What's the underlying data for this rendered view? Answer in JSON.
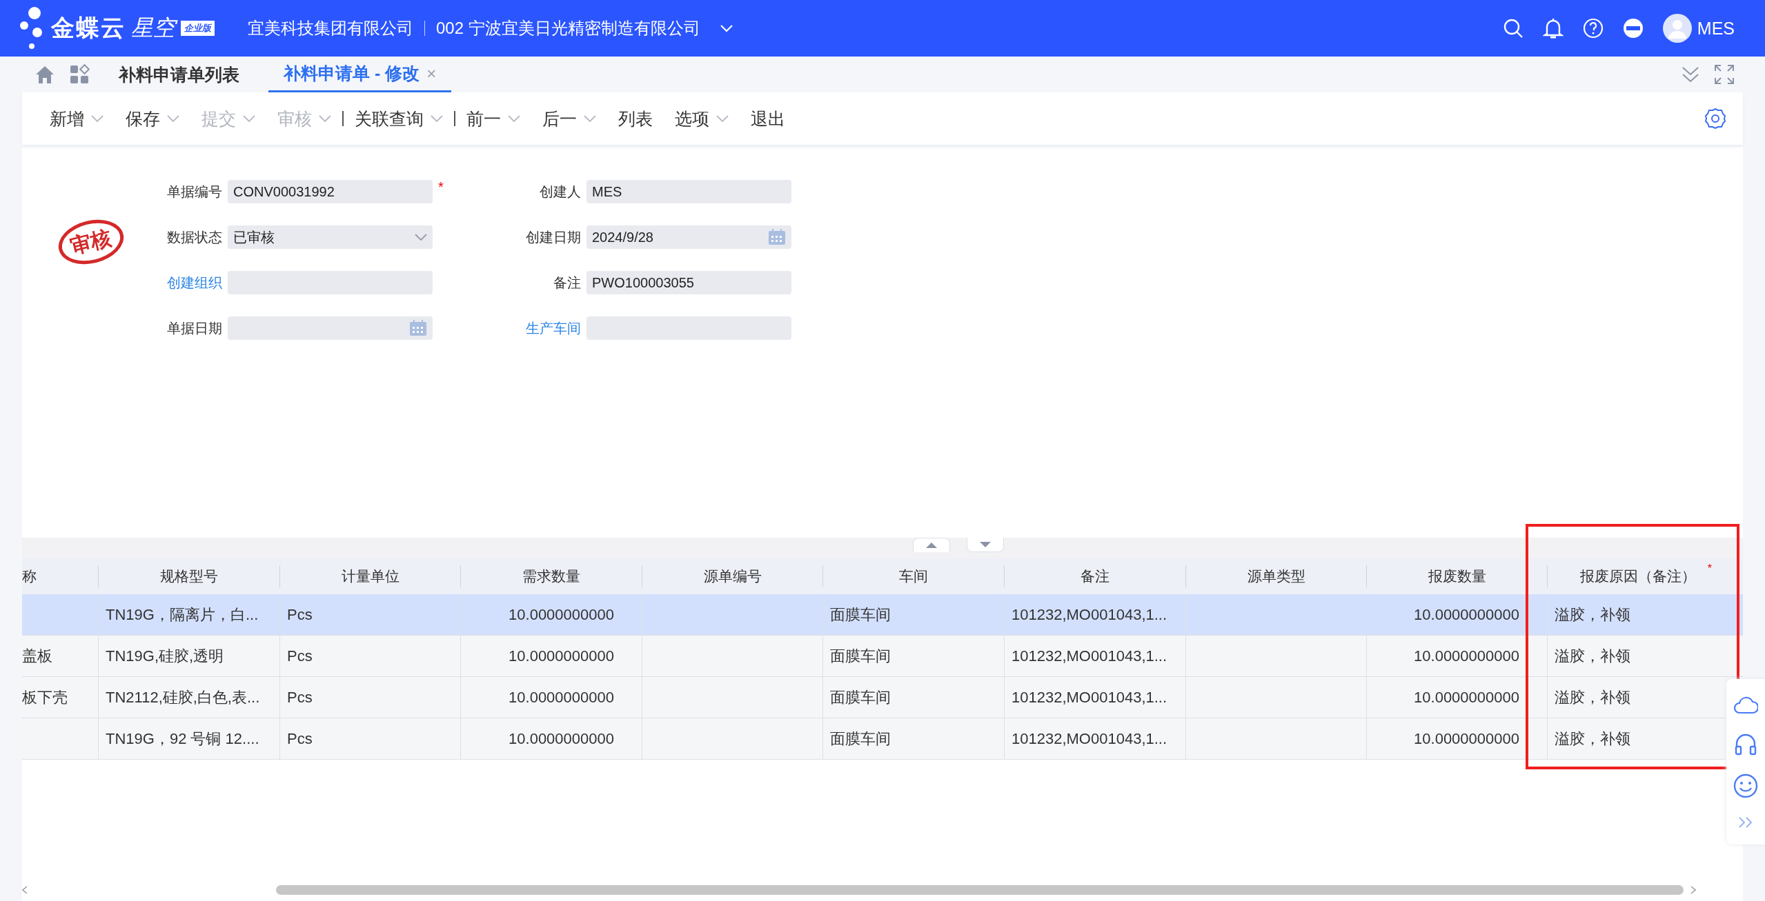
{
  "header": {
    "logo_text": "金蝶云",
    "logo_sub": "星空",
    "edition": "企业版",
    "company": "宜美科技集团有限公司",
    "org": "002 宁波宜美日光精密制造有限公司",
    "user": "MES"
  },
  "tabs": [
    {
      "label": "补料申请单列表",
      "selected": false,
      "closable": false
    },
    {
      "label": "补料申请单 - 修改",
      "selected": true,
      "closable": true
    }
  ],
  "close_glyph": "×",
  "toolbar": [
    {
      "label": "新增",
      "dropdown": true,
      "disabled": false,
      "separator_after": false
    },
    {
      "label": "保存",
      "dropdown": true,
      "disabled": false,
      "separator_after": false
    },
    {
      "label": "提交",
      "dropdown": true,
      "disabled": true,
      "separator_after": false
    },
    {
      "label": "审核",
      "dropdown": true,
      "disabled": true,
      "separator_after": true
    },
    {
      "label": "关联查询",
      "dropdown": true,
      "disabled": false,
      "separator_after": true
    },
    {
      "label": "前一",
      "dropdown": true,
      "disabled": false,
      "separator_after": false
    },
    {
      "label": "后一",
      "dropdown": true,
      "disabled": false,
      "separator_after": false
    },
    {
      "label": "列表",
      "dropdown": false,
      "disabled": false,
      "separator_after": false
    },
    {
      "label": "选项",
      "dropdown": true,
      "disabled": false,
      "separator_after": false
    },
    {
      "label": "退出",
      "dropdown": false,
      "disabled": false,
      "separator_after": false
    }
  ],
  "stamp": "审核",
  "form_left": [
    {
      "label": "单据编号",
      "value": "CONV00031992",
      "kind": "text",
      "link": false,
      "required": true
    },
    {
      "label": "数据状态",
      "value": "已审核",
      "kind": "select",
      "link": false,
      "required": false
    },
    {
      "label": "创建组织",
      "kind": "text",
      "link": true,
      "required": false
    },
    {
      "label": "单据日期",
      "kind": "date",
      "link": false,
      "required": false
    }
  ],
  "form_right": [
    {
      "label": "创建人",
      "value": "MES",
      "kind": "text",
      "link": false,
      "required": false
    },
    {
      "label": "创建日期",
      "value": "2024/9/28",
      "kind": "date",
      "link": false,
      "required": false
    },
    {
      "label": "备注",
      "value": "PWO100003055",
      "kind": "text",
      "link": false,
      "required": false
    },
    {
      "label": "生产车间",
      "kind": "text",
      "link": true,
      "required": false
    }
  ],
  "required_mark": "*",
  "table": {
    "columns": [
      {
        "label": "称",
        "kind": "text",
        "required": false,
        "highlighted": false
      },
      {
        "label": "规格型号",
        "kind": "text",
        "required": false,
        "highlighted": false
      },
      {
        "label": "计量单位",
        "kind": "text",
        "required": false,
        "highlighted": false
      },
      {
        "label": "需求数量",
        "kind": "number",
        "required": false,
        "highlighted": false
      },
      {
        "label": "源单编号",
        "kind": "text",
        "required": false,
        "highlighted": false
      },
      {
        "label": "车间",
        "kind": "text",
        "required": false,
        "highlighted": false
      },
      {
        "label": "备注",
        "kind": "text",
        "required": false,
        "highlighted": false
      },
      {
        "label": "源单类型",
        "kind": "text",
        "required": false,
        "highlighted": false
      },
      {
        "label": "报废数量",
        "kind": "number",
        "required": false,
        "highlighted": false
      },
      {
        "label": "报废原因（备注）",
        "kind": "text",
        "required": true,
        "highlighted": true
      }
    ],
    "rows": [
      {
        "selected": true,
        "cells": [
          "",
          "TN19G，隔离片，白...",
          "Pcs",
          "10.0000000000",
          "",
          "面膜车间",
          "101232,MO001043,1...",
          "",
          "10.0000000000",
          "溢胶，补领"
        ]
      },
      {
        "selected": false,
        "cells": [
          "盖板",
          "TN19G,硅胶,透明",
          "Pcs",
          "10.0000000000",
          "",
          "面膜车间",
          "101232,MO001043,1...",
          "",
          "10.0000000000",
          "溢胶，补领"
        ]
      },
      {
        "selected": false,
        "cells": [
          "板下壳",
          "TN2112,硅胶,白色,表...",
          "Pcs",
          "10.0000000000",
          "",
          "面膜车间",
          "101232,MO001043,1...",
          "",
          "10.0000000000",
          "溢胶，补领"
        ]
      },
      {
        "selected": false,
        "cells": [
          "",
          "TN19G，92 号铜 12....",
          "Pcs",
          "10.0000000000",
          "",
          "面膜车间",
          "101232,MO001043,1...",
          "",
          "10.0000000000",
          "溢胶，补领"
        ]
      }
    ]
  }
}
